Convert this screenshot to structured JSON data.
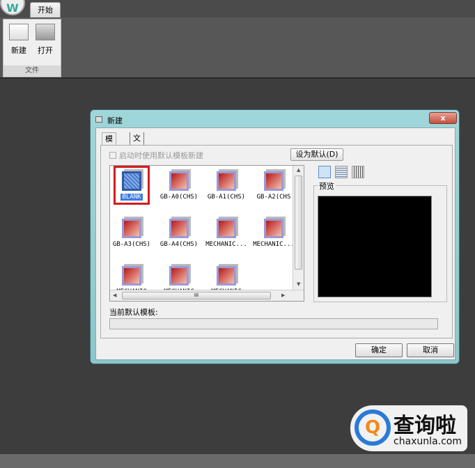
{
  "app": {
    "logo_letter": "W",
    "ribbon_tab": "开始",
    "group": {
      "label": "文件",
      "buttons": [
        {
          "label": "新建",
          "icon": "new-file-icon"
        },
        {
          "label": "打开",
          "icon": "open-folder-icon"
        }
      ]
    }
  },
  "dialog": {
    "title": "新建",
    "close": "x",
    "tabs": [
      "模板",
      "文档恢复"
    ],
    "checkbox_label": "启动时使用默认模板新建",
    "checkbox_checked": false,
    "set_default_button": "设为默认(D)",
    "templates": [
      "BLANK",
      "GB-A0(CHS)",
      "GB-A1(CHS)",
      "GB-A2(CHS",
      "GB-A3(CHS)",
      "GB-A4(CHS)",
      "MECHANIC...",
      "MECHANIC...",
      "MECHANIC",
      "MECHANIC",
      "MECHANIC"
    ],
    "selected_template": "BLANK",
    "view_modes": [
      "large-icons-view-icon",
      "list-view-icon",
      "details-view-icon"
    ],
    "preview_label": "预览",
    "current_default_label": "当前默认模板:",
    "current_default_value": "",
    "ok_button": "确定",
    "cancel_button": "取消",
    "hscroll_grip": "III"
  },
  "watermark": {
    "text": "查询啦",
    "url": "chaxunla.com"
  },
  "colors": {
    "highlight": "#d21c1c",
    "title_bar": "#9fd6da",
    "selection": "#3a7be0"
  }
}
